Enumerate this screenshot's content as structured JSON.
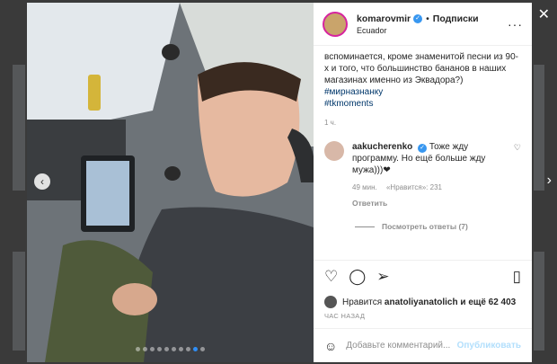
{
  "post": {
    "username": "komarovmir",
    "follow_label": "Подписки",
    "location": "Ecuador",
    "caption": "вспоминается, кроме знаменитой песни из 90-х и того, что большинство бананов в наших магазинах именно из Эквадора?)",
    "hashtags": [
      "#мирназнанку",
      "#tkmoments"
    ],
    "time": "1 ч."
  },
  "comment": {
    "username": "aakucherenko",
    "text": "Тоже жду программу. Но ещё больше жду мужа)))❤",
    "time": "49 мин.",
    "likes_label": "«Нравится»: 231",
    "reply_label": "Ответить",
    "view_replies": "Посмотреть ответы (7)"
  },
  "likes": {
    "prefix": "Нравится",
    "user": "anatoliyanatolich",
    "suffix": "и ещё 62 403"
  },
  "ago_label": "ЧАС НАЗАД",
  "add_comment": {
    "placeholder": "Добавьте комментарий...",
    "publish": "Опубликовать"
  },
  "colors": {
    "link": "#00376b",
    "accent": "#3897f0",
    "publish_disabled": "#b2dffc"
  }
}
